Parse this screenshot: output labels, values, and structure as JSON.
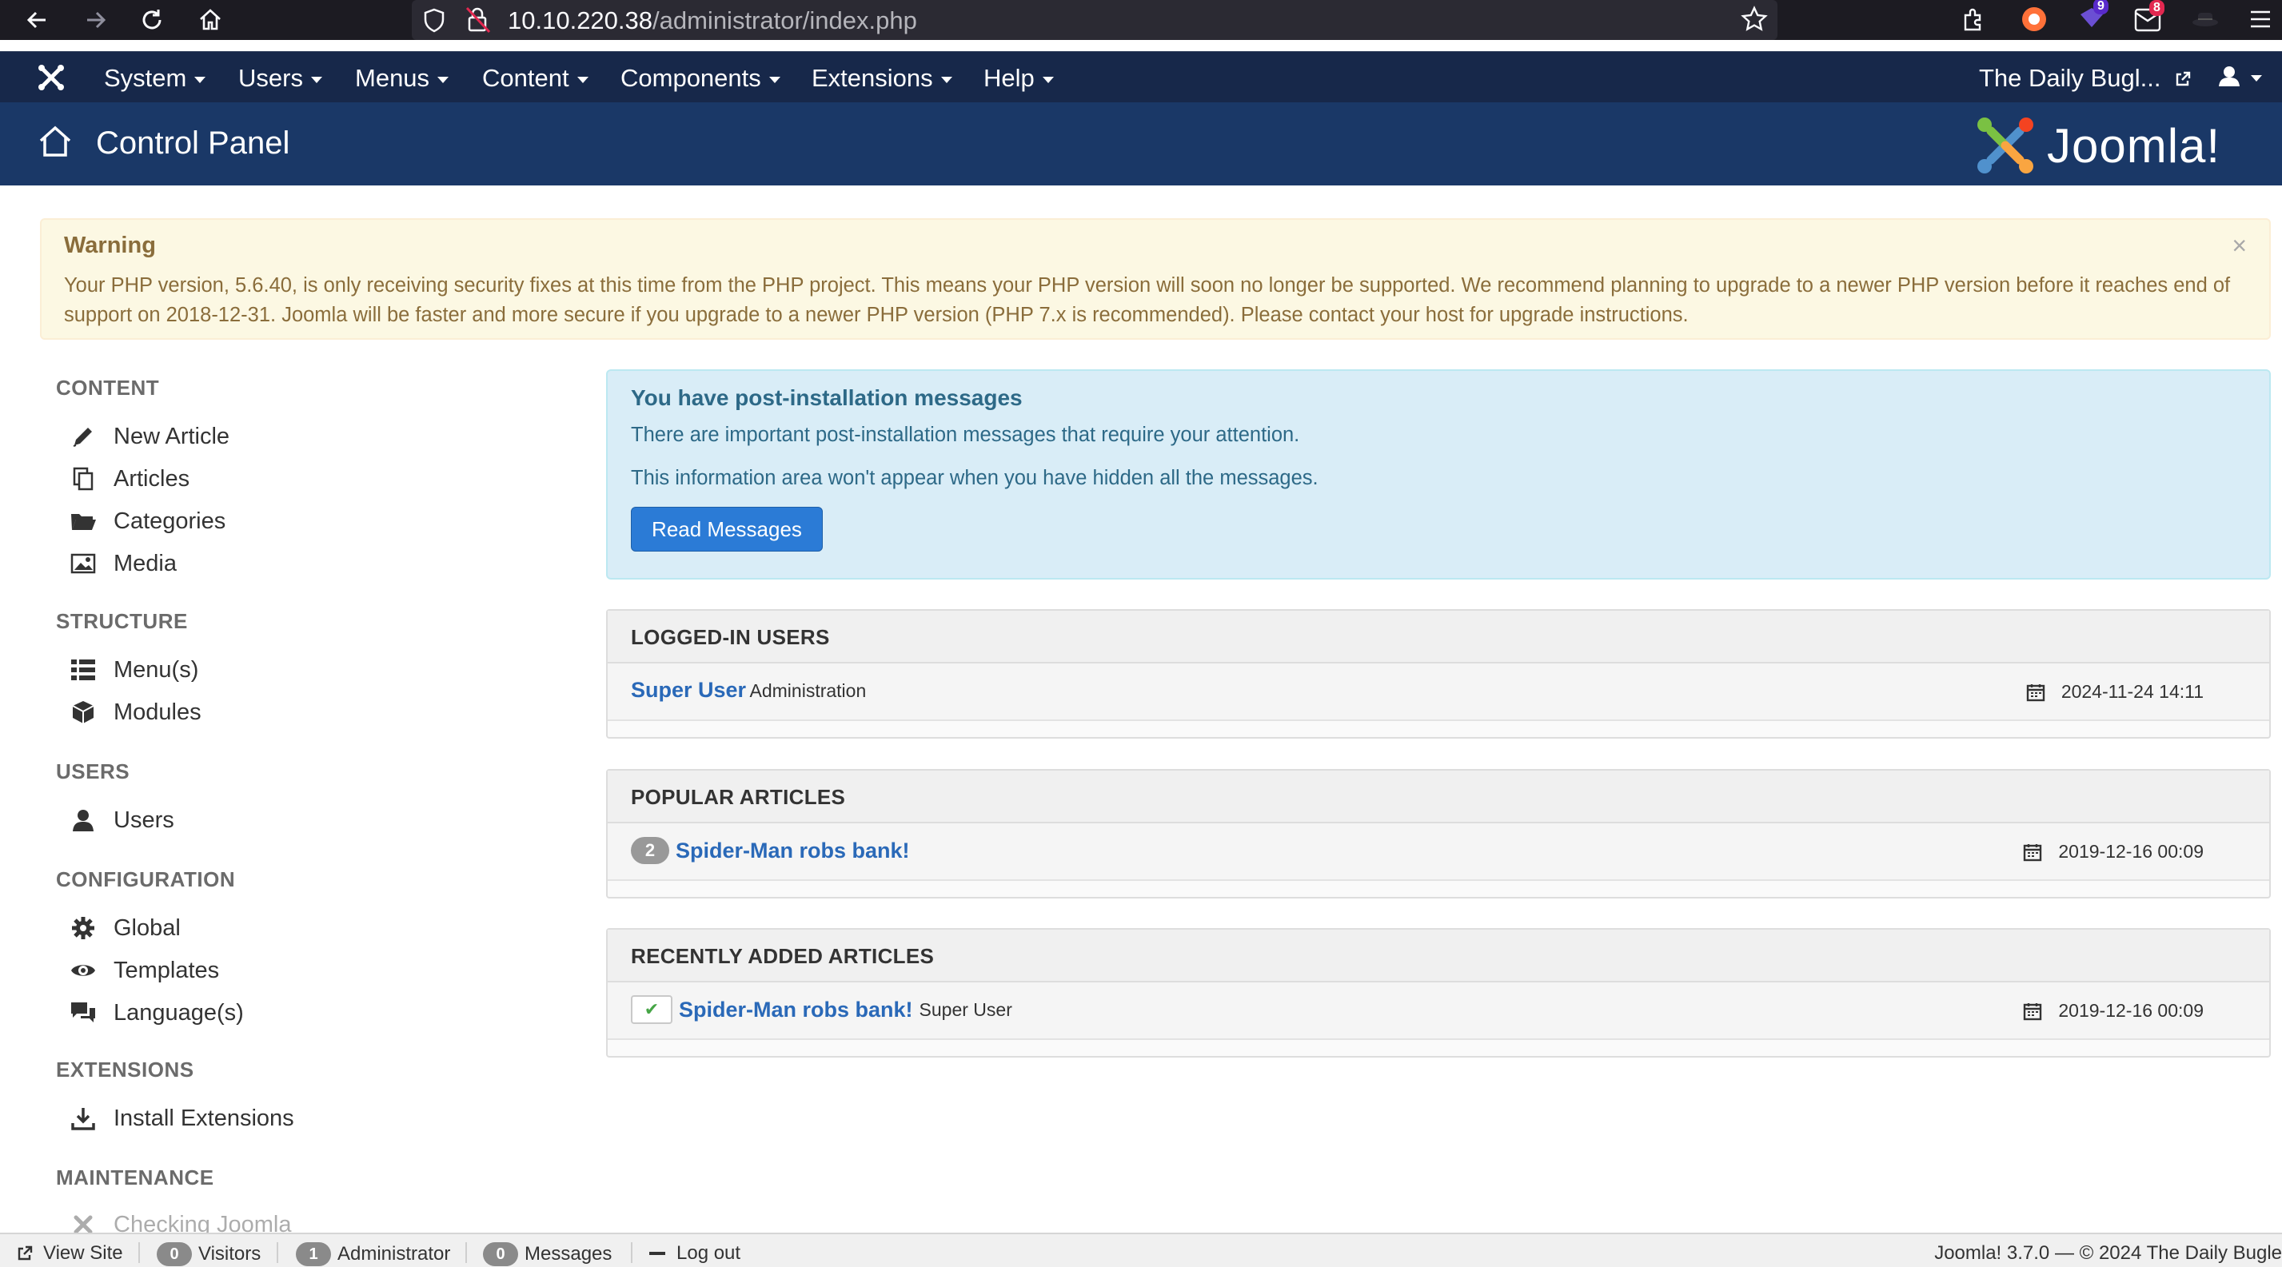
{
  "browser": {
    "url_host": "10.10.220.38",
    "url_path": "/administrator/index.php",
    "ext_badge_1": "9",
    "ext_badge_2": "8"
  },
  "topnav": {
    "items": [
      "System",
      "Users",
      "Menus",
      "Content",
      "Components",
      "Extensions",
      "Help"
    ],
    "site_name": "The Daily Bugl..."
  },
  "subheader": {
    "title": "Control Panel",
    "brand": "Joomla!"
  },
  "warning": {
    "title": "Warning",
    "text": "Your PHP version, 5.6.40, is only receiving security fixes at this time from the PHP project. This means your PHP version will soon no longer be supported. We recommend planning to upgrade to a newer PHP version before it reaches end of support on 2018-12-31. Joomla will be faster and more secure if you upgrade to a newer PHP version (PHP 7.x is recommended). Please contact your host for upgrade instructions.",
    "close": "×"
  },
  "sidebar": {
    "content_heading": "CONTENT",
    "new_article": "New Article",
    "articles": "Articles",
    "categories": "Categories",
    "media": "Media",
    "structure_heading": "STRUCTURE",
    "menus": "Menu(s)",
    "modules": "Modules",
    "users_heading": "USERS",
    "users": "Users",
    "configuration_heading": "CONFIGURATION",
    "global": "Global",
    "templates": "Templates",
    "languages": "Language(s)",
    "extensions_heading": "EXTENSIONS",
    "install_extensions": "Install Extensions",
    "maintenance_heading": "MAINTENANCE",
    "checkin": "Checking Joomla"
  },
  "postinstall": {
    "title": "You have post-installation messages",
    "text1": "There are important post-installation messages that require your attention.",
    "text2": "This information area won't appear when you have hidden all the messages.",
    "button": "Read Messages"
  },
  "logged_in": {
    "title": "LOGGED-IN USERS",
    "user": "Super User",
    "location": "Administration",
    "date": "2024-11-24 14:11"
  },
  "popular": {
    "title": "POPULAR ARTICLES",
    "hits": "2",
    "article": "Spider-Man robs bank!",
    "date": "2019-12-16 00:09"
  },
  "recent": {
    "title": "RECENTLY ADDED ARTICLES",
    "article": "Spider-Man robs bank!",
    "author": "Super User",
    "date": "2019-12-16 00:09"
  },
  "statusbar": {
    "view_site": "View Site",
    "visitors_count": "0",
    "visitors": "Visitors",
    "admin_count": "1",
    "administrator": "Administrator",
    "messages_count": "0",
    "messages": "Messages",
    "logout": "Log out",
    "footer": "Joomla! 3.7.0  —  © 2024 The Daily Bugle"
  }
}
